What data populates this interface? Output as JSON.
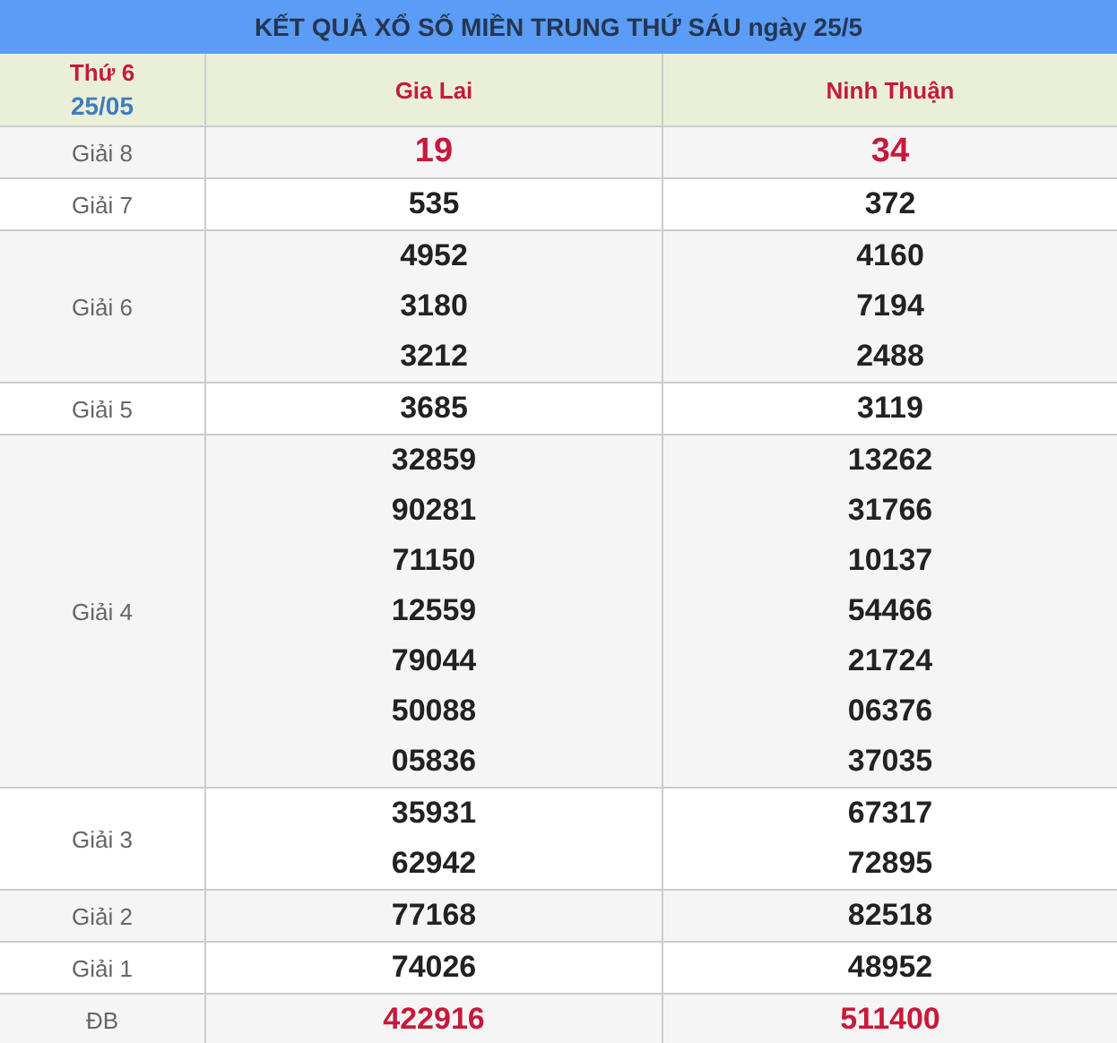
{
  "title": "KẾT QUẢ XỔ SỐ MIỀN TRUNG THỨ SÁU ngày 25/5",
  "header": {
    "weekday": "Thứ 6",
    "date": "25/05",
    "provinces": [
      "Gia Lai",
      "Ninh Thuận"
    ]
  },
  "rows": [
    {
      "label": "Giải 8",
      "kind": "big-red",
      "results": [
        [
          "19"
        ],
        [
          "34"
        ]
      ]
    },
    {
      "label": "Giải 7",
      "kind": "regular",
      "results": [
        [
          "535"
        ],
        [
          "372"
        ]
      ]
    },
    {
      "label": "Giải 6",
      "kind": "regular",
      "results": [
        [
          "4952",
          "3180",
          "3212"
        ],
        [
          "4160",
          "7194",
          "2488"
        ]
      ]
    },
    {
      "label": "Giải 5",
      "kind": "regular",
      "results": [
        [
          "3685"
        ],
        [
          "3119"
        ]
      ]
    },
    {
      "label": "Giải 4",
      "kind": "regular",
      "results": [
        [
          "32859",
          "90281",
          "71150",
          "12559",
          "79044",
          "50088",
          "05836"
        ],
        [
          "13262",
          "31766",
          "10137",
          "54466",
          "21724",
          "06376",
          "37035"
        ]
      ]
    },
    {
      "label": "Giải 3",
      "kind": "regular",
      "results": [
        [
          "35931",
          "62942"
        ],
        [
          "67317",
          "72895"
        ]
      ]
    },
    {
      "label": "Giải 2",
      "kind": "regular",
      "results": [
        [
          "77168"
        ],
        [
          "82518"
        ]
      ]
    },
    {
      "label": "Giải 1",
      "kind": "regular",
      "results": [
        [
          "74026"
        ],
        [
          "48952"
        ]
      ]
    },
    {
      "label": "ĐB",
      "kind": "red",
      "results": [
        [
          "422916"
        ],
        [
          "511400"
        ]
      ]
    }
  ]
}
